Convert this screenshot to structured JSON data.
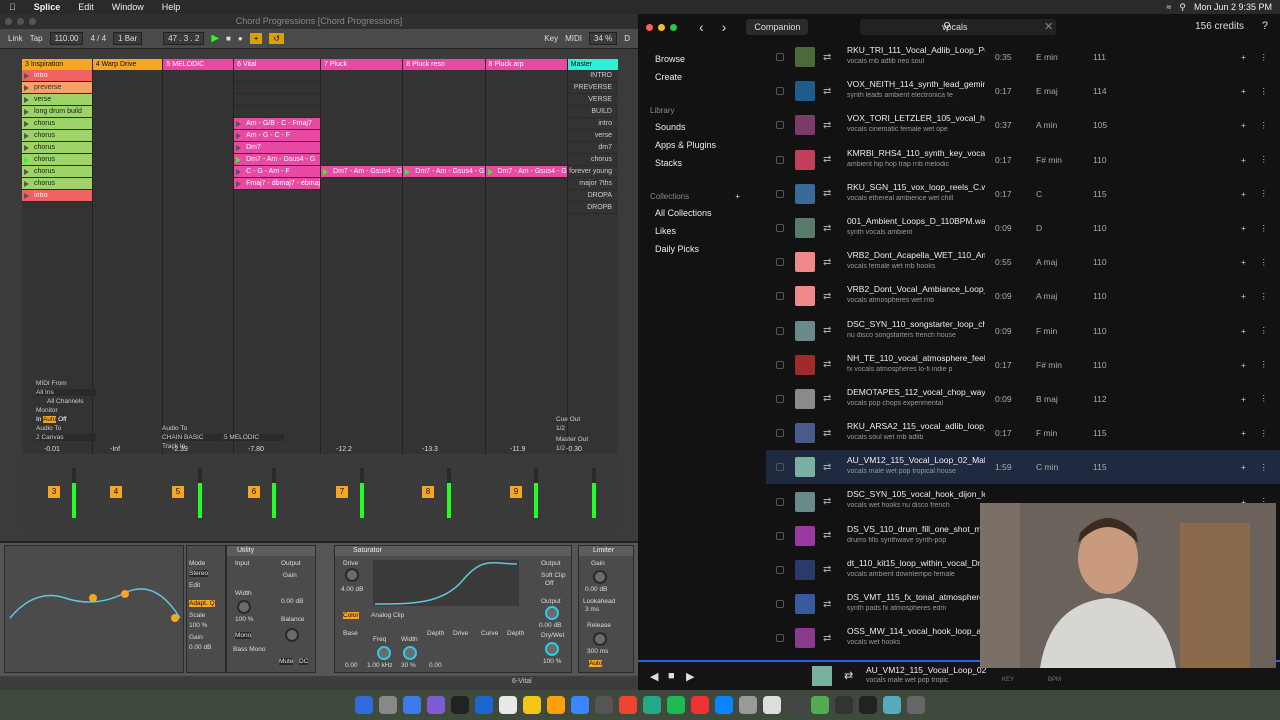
{
  "menubar": {
    "items": [
      "Splice",
      "Edit",
      "Window",
      "Help"
    ],
    "date": "Mon Jun 2  9:35 PM"
  },
  "ableton": {
    "title": "Chord Progressions  [Chord Progressions]",
    "ctrl": {
      "link": "Link",
      "tap": "Tap",
      "tempo": "110.00",
      "sig": "4 / 4",
      "bar": "1 Bar",
      "pos": "47 .  3 .  2",
      "key": "Key",
      "midi": "MIDI",
      "cpu": "34 %",
      "d": "D"
    },
    "tracks": [
      {
        "name": "3 Inspiration",
        "color": "#f5a623"
      },
      {
        "name": "4 Warp Drive",
        "color": "#f5a623"
      },
      {
        "name": "5 MELODIC",
        "color": "#e84aa3"
      },
      {
        "name": "6 Vital",
        "color": "#e84aa3"
      },
      {
        "name": "7 Pluck",
        "color": "#e84aa3"
      },
      {
        "name": "8 Pluck reso",
        "color": "#e84aa3"
      },
      {
        "name": "8 Pluck arp",
        "color": "#e84aa3"
      }
    ],
    "track1_clips": [
      "intro",
      "preverse",
      "verse",
      "long drum build",
      "chorus",
      "chorus",
      "chorus",
      "chorus",
      "chorus",
      "chorus",
      "intro"
    ],
    "track4_clips": [
      "Am - G/B - C - Fmaj7",
      "Am - G - C - F",
      "Dm7",
      "Dm7 - Am - Gsus4 - G",
      "C - G - Am - F",
      "Fmaj7 - dbmaj7 - ebmaj"
    ],
    "track5_clip": "Dm7 - Am - Gsus4 - G",
    "track6_clip": "Dm7 - Am - Gsus4 - G",
    "track7_clip": "Dm7 - Am - Gsus4 - G",
    "master": {
      "name": "Master",
      "scenes": [
        "INTRO",
        "PREVERSE",
        "VERSE",
        "BUILD",
        "intro",
        "verse",
        "dm7",
        "chorus",
        "forever young",
        "major 7ths",
        "DROPA",
        "DROPB"
      ]
    },
    "io": {
      "midi_from": "MIDI From",
      "all_ins": "All Ins",
      "all_channels": "All Channels",
      "monitor": "Monitor",
      "in": "In",
      "auto": "Auto",
      "off": "Off",
      "audio_to": "Audio To",
      "canvas": "2 Canvas",
      "melodic": "5 MELODIC",
      "chain_basic": "CHAIN BASIC",
      "track_in": "Track In",
      "cue_out": "Cue Out",
      "cue_val": "1/2",
      "master_out": "Master Out",
      "master_val": "1/2"
    },
    "mixer": {
      "levels": [
        "-0.01",
        "-Inf",
        "-2.39",
        "-7.80",
        "-12.2",
        "-13.3",
        "-11.9",
        "-0.30"
      ],
      "nums": [
        "3",
        "4",
        "5",
        "6",
        "7",
        "8",
        "9"
      ]
    },
    "devices": {
      "utility": {
        "name": "Utility",
        "labels": [
          "Input",
          "Output",
          "Gain",
          "Width",
          "Mono",
          "Balance",
          "Bass Mono",
          "Mute",
          "DC"
        ],
        "gain": "0.00 dB",
        "width": "100 %"
      },
      "saturator": {
        "name": "Saturator",
        "drive": "Drive",
        "drive_val": "4.00 dB",
        "color": "Color",
        "mode": "Analog Clip",
        "soft": "Soft Clip",
        "soft_val": "Off",
        "output": "Output",
        "out_val": "0.00 dB",
        "drywet": "Dry/Wet",
        "dw_val": "100 %",
        "labels": [
          "Base",
          "Freq",
          "Width",
          "Depth",
          "Drive",
          "Curve",
          "Depth"
        ],
        "vals": [
          "0.00",
          "1.00 kHz",
          "30 %",
          "0.00"
        ]
      },
      "limiter": {
        "name": "Limiter",
        "gain": "Gain",
        "gain_val": "0.00 dB",
        "lookahead": "Lookahead",
        "la_val": "3 ms",
        "release": "Release",
        "rel_val": "300 ms",
        "auto": "Auto"
      },
      "eq": {
        "mode": "Mode",
        "adapt": "Adapt. Q",
        "scale": "Scale",
        "scale_val": "100 %",
        "gain": "Gain",
        "gain_val": "0.00 dB",
        "edit": "Edit",
        "stereo": "Stereo"
      }
    },
    "status": "6-Vital"
  },
  "splice": {
    "tab": "Companion",
    "search": "vocals",
    "credits": "156 credits",
    "nav": [
      "Browse",
      "Create"
    ],
    "library_label": "Library",
    "library": [
      "Sounds",
      "Apps & Plugins",
      "Stacks"
    ],
    "collections_label": "Collections",
    "collections": [
      "All Collections",
      "Likes",
      "Daily Picks"
    ],
    "rows": [
      {
        "name": "RKU_TRI_111_Vocal_Adlib_Loop_Push",
        "tags": "vocals   rnb   adlib   neo soul",
        "time": "0:35",
        "key": "E min",
        "bpm": "111",
        "art": "#4a6a3a"
      },
      {
        "name": "VOX_NEITH_114_synth_lead_gemini_E",
        "tags": "synth   leads   ambient   electronica   fe",
        "time": "0:17",
        "key": "E maj",
        "bpm": "114",
        "art": "#1f5c8a"
      },
      {
        "name": "VOX_TORI_LETZLER_105_vocal_hook",
        "tags": "vocals   cinematic   female   wet   ope",
        "time": "0:37",
        "key": "A min",
        "bpm": "105",
        "art": "#7a3a6a"
      },
      {
        "name": "KMRBI_RHS4_110_synth_key_vocal_lo",
        "tags": "ambient   hip hop   trap   rnb   melodic",
        "time": "0:17",
        "key": "F# min",
        "bpm": "110",
        "art": "#c0405a"
      },
      {
        "name": "RKU_SGN_115_vox_loop_reels_C.wav",
        "tags": "vocals   ethereal   ambience   wet   chill",
        "time": "0:17",
        "key": "C",
        "bpm": "115",
        "art": "#3a6a9a"
      },
      {
        "name": "001_Ambient_Loops_D_110BPM.wav",
        "tags": "synth   vocals   ambient",
        "time": "0:09",
        "key": "D",
        "bpm": "110",
        "art": "#5a7a6a"
      },
      {
        "name": "VRB2_Dont_Acapella_WET_110_Amaj",
        "tags": "vocals   female   wet   rnb   hooks",
        "time": "0:55",
        "key": "A maj",
        "bpm": "110",
        "art": "#f08a8a"
      },
      {
        "name": "VRB2_Dont_Vocal_Ambiance_Loop_0",
        "tags": "vocals   atmospheres   wet   rnb",
        "time": "0:09",
        "key": "A maj",
        "bpm": "110",
        "art": "#f08a8a"
      },
      {
        "name": "DSC_SYN_110_songstarter_loop_chic",
        "tags": "nu disco   songstarters   french house",
        "time": "0:09",
        "key": "F min",
        "bpm": "110",
        "art": "#6a8a8a"
      },
      {
        "name": "NH_TE_110_vocal_atmosphere_feels_F",
        "tags": "fx   vocals   atmospheres   lo-fi   indie p",
        "time": "0:17",
        "key": "F# min",
        "bpm": "110",
        "art": "#a02a2a"
      },
      {
        "name": "DEMOTAPES_112_vocal_chop_way_b",
        "tags": "vocals   pop   chops   experimental",
        "time": "0:09",
        "key": "B maj",
        "bpm": "112",
        "art": "#8a8a8a"
      },
      {
        "name": "RKU_ARSA2_115_vocal_adlib_loop_ik",
        "tags": "vocals   soul   wet   rnb   adlib",
        "time": "0:17",
        "key": "F min",
        "bpm": "115",
        "art": "#4a5a8a"
      },
      {
        "name": "AU_VM12_115_Vocal_Loop_02_Male_I",
        "tags": "vocals   male   wet   pop   tropical house",
        "time": "1:59",
        "key": "C min",
        "bpm": "115",
        "art": "#7ab0a0"
      },
      {
        "name": "DSC_SYN_105_vocal_hook_dijon_lea",
        "tags": "vocals   wet   hooks   nu disco   french",
        "time": "",
        "key": "",
        "bpm": "",
        "art": "#6a8a8a"
      },
      {
        "name": "DS_VS_110_drum_fill_one_shot_mon",
        "tags": "drums   fills   synthwave   synth-pop",
        "time": "",
        "key": "",
        "bpm": "",
        "art": "#9a3aa0"
      },
      {
        "name": "dt_110_kit15_loop_within_vocal_Dma",
        "tags": "vocals   ambient   downtempo   female",
        "time": "",
        "key": "",
        "bpm": "",
        "art": "#2a3a6a"
      },
      {
        "name": "DS_VMT_115_fx_tonal_atmosphere_F",
        "tags": "synth   pads   fx   atmospheres   edm",
        "time": "",
        "key": "",
        "bpm": "",
        "art": "#3a5aa0"
      },
      {
        "name": "OSS_MW_114_vocal_hook_loop_abo",
        "tags": "vocals   wet   hooks",
        "time": "",
        "key": "",
        "bpm": "",
        "art": "#8a3a8a"
      }
    ],
    "player": {
      "name": "AU_VM12_115_Vocal_Loop_02",
      "tags": "vocals   male   wet   pop   tropic",
      "key": "KEY",
      "bpm": "BPM",
      "bridge": "BRIDGE"
    }
  }
}
